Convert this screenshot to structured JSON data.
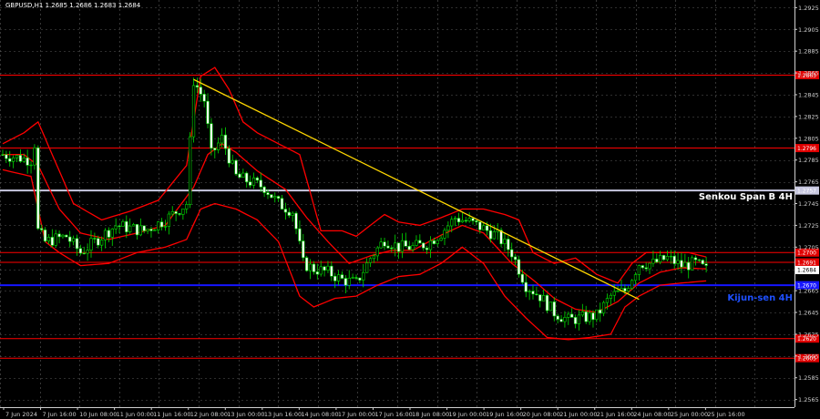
{
  "chart_data": {
    "type": "candlestick",
    "title": "GBPUSD,H1  1.2685 1.2686 1.2683 1.2684",
    "x_labels": [
      "7 Jun 2024",
      "7 Jun 16:00",
      "10 Jun 08:00",
      "11 Jun 00:00",
      "11 Jun 16:00",
      "12 Jun 08:00",
      "13 Jun 00:00",
      "13 Jun 16:00",
      "14 Jun 08:00",
      "17 Jun 00:00",
      "17 Jun 16:00",
      "18 Jun 08:00",
      "19 Jun 00:00",
      "19 Jun 16:00",
      "20 Jun 08:00",
      "21 Jun 00:00",
      "21 Jun 16:00",
      "24 Jun 08:00",
      "25 Jun 00:00",
      "25 Jun 16:00"
    ],
    "y_ticks": [
      "1.2925",
      "1.2905",
      "1.2885",
      "1.2865",
      "1.2845",
      "1.2825",
      "1.2805",
      "1.2785",
      "1.2765",
      "1.2745",
      "1.2725",
      "1.2705",
      "1.2684",
      "1.2665",
      "1.2645",
      "1.2625",
      "1.2605",
      "1.2585",
      "1.2565"
    ],
    "ylim": [
      1.2558,
      1.2932
    ],
    "n_bars": 200,
    "levels": [
      {
        "value": 1.2863,
        "color": "#ff0000",
        "tag": "1.2863"
      },
      {
        "value": 1.2796,
        "color": "#ff0000",
        "tag": "1.2796"
      },
      {
        "value": 1.27,
        "color": "#ff0000",
        "tag": "1.2700"
      },
      {
        "value": 1.2691,
        "color": "#ff0000",
        "tag": "1.2691"
      },
      {
        "value": 1.2621,
        "color": "#ff0000",
        "tag": "1.2620"
      },
      {
        "value": 1.2603,
        "color": "#ff0000",
        "tag": "1.2605"
      }
    ],
    "senkou_span_b": {
      "value": 1.2757,
      "label": "Senkou Span B 4H",
      "tag": "1.2757",
      "color": "#c8c8e0"
    },
    "kijun_sen": {
      "value": 1.267,
      "label": "Kijun-sen 4H",
      "tag": "1.2670",
      "color": "#1515ff"
    },
    "current_price": {
      "value": 1.2684,
      "tag": "1.2684"
    },
    "trendline": {
      "start": {
        "bar": 54,
        "price": 1.2859
      },
      "end": {
        "bar": 180,
        "price": 1.2657
      },
      "color": "#ffd700"
    },
    "price_path": [
      [
        0,
        1.279
      ],
      [
        8,
        1.2785
      ],
      [
        9,
        1.28
      ],
      [
        10,
        1.272
      ],
      [
        12,
        1.271
      ],
      [
        18,
        1.2715
      ],
      [
        22,
        1.27
      ],
      [
        26,
        1.271
      ],
      [
        32,
        1.2725
      ],
      [
        40,
        1.272
      ],
      [
        46,
        1.273
      ],
      [
        52,
        1.2745
      ],
      [
        54,
        1.2858
      ],
      [
        57,
        1.284
      ],
      [
        59,
        1.279
      ],
      [
        62,
        1.2805
      ],
      [
        66,
        1.277
      ],
      [
        70,
        1.2765
      ],
      [
        74,
        1.276
      ],
      [
        78,
        1.2745
      ],
      [
        82,
        1.2738
      ],
      [
        85,
        1.269
      ],
      [
        88,
        1.2685
      ],
      [
        92,
        1.2682
      ],
      [
        96,
        1.2675
      ],
      [
        100,
        1.2672
      ],
      [
        104,
        1.2695
      ],
      [
        108,
        1.2712
      ],
      [
        112,
        1.2705
      ],
      [
        116,
        1.2705
      ],
      [
        120,
        1.2708
      ],
      [
        124,
        1.2718
      ],
      [
        128,
        1.2732
      ],
      [
        132,
        1.2728
      ],
      [
        136,
        1.2722
      ],
      [
        140,
        1.2715
      ],
      [
        144,
        1.27
      ],
      [
        148,
        1.267
      ],
      [
        152,
        1.266
      ],
      [
        156,
        1.2645
      ],
      [
        160,
        1.2638
      ],
      [
        164,
        1.264
      ],
      [
        168,
        1.2642
      ],
      [
        172,
        1.266
      ],
      [
        176,
        1.2665
      ],
      [
        180,
        1.269
      ],
      [
        184,
        1.269
      ],
      [
        188,
        1.2695
      ],
      [
        192,
        1.2688
      ],
      [
        196,
        1.269
      ],
      [
        199,
        1.2684
      ]
    ],
    "bands_upper_path": [
      [
        0,
        1.28
      ],
      [
        6,
        1.281
      ],
      [
        10,
        1.282
      ],
      [
        14,
        1.279
      ],
      [
        20,
        1.2745
      ],
      [
        28,
        1.273
      ],
      [
        36,
        1.2738
      ],
      [
        44,
        1.2748
      ],
      [
        52,
        1.278
      ],
      [
        56,
        1.2862
      ],
      [
        60,
        1.287
      ],
      [
        64,
        1.285
      ],
      [
        68,
        1.282
      ],
      [
        72,
        1.281
      ],
      [
        78,
        1.28
      ],
      [
        84,
        1.279
      ],
      [
        90,
        1.272
      ],
      [
        96,
        1.272
      ],
      [
        100,
        1.2715
      ],
      [
        104,
        1.2725
      ],
      [
        108,
        1.2735
      ],
      [
        112,
        1.2728
      ],
      [
        118,
        1.2725
      ],
      [
        124,
        1.2732
      ],
      [
        130,
        1.274
      ],
      [
        136,
        1.274
      ],
      [
        142,
        1.2735
      ],
      [
        146,
        1.273
      ],
      [
        150,
        1.27
      ],
      [
        156,
        1.269
      ],
      [
        162,
        1.2695
      ],
      [
        168,
        1.268
      ],
      [
        174,
        1.2672
      ],
      [
        178,
        1.269
      ],
      [
        182,
        1.27
      ],
      [
        188,
        1.27
      ],
      [
        194,
        1.27
      ],
      [
        199,
        1.2696
      ]
    ],
    "bands_mid_path": [
      [
        0,
        1.279
      ],
      [
        6,
        1.279
      ],
      [
        10,
        1.278
      ],
      [
        16,
        1.274
      ],
      [
        22,
        1.2718
      ],
      [
        30,
        1.2712
      ],
      [
        38,
        1.2718
      ],
      [
        46,
        1.2725
      ],
      [
        54,
        1.276
      ],
      [
        58,
        1.279
      ],
      [
        62,
        1.28
      ],
      [
        66,
        1.2792
      ],
      [
        72,
        1.2775
      ],
      [
        80,
        1.2758
      ],
      [
        86,
        1.2732
      ],
      [
        92,
        1.271
      ],
      [
        98,
        1.269
      ],
      [
        104,
        1.2697
      ],
      [
        110,
        1.2702
      ],
      [
        116,
        1.2702
      ],
      [
        124,
        1.2716
      ],
      [
        130,
        1.2725
      ],
      [
        136,
        1.2718
      ],
      [
        144,
        1.269
      ],
      [
        150,
        1.2675
      ],
      [
        156,
        1.2658
      ],
      [
        162,
        1.2648
      ],
      [
        168,
        1.2645
      ],
      [
        174,
        1.2655
      ],
      [
        180,
        1.2672
      ],
      [
        186,
        1.2682
      ],
      [
        192,
        1.2686
      ],
      [
        199,
        1.2685
      ]
    ],
    "bands_lower_path": [
      [
        0,
        1.2776
      ],
      [
        8,
        1.277
      ],
      [
        12,
        1.271
      ],
      [
        16,
        1.27
      ],
      [
        22,
        1.2688
      ],
      [
        30,
        1.269
      ],
      [
        38,
        1.27
      ],
      [
        46,
        1.2705
      ],
      [
        52,
        1.2712
      ],
      [
        56,
        1.274
      ],
      [
        60,
        1.2745
      ],
      [
        66,
        1.274
      ],
      [
        72,
        1.273
      ],
      [
        78,
        1.271
      ],
      [
        84,
        1.266
      ],
      [
        88,
        1.265
      ],
      [
        94,
        1.2658
      ],
      [
        100,
        1.266
      ],
      [
        106,
        1.267
      ],
      [
        112,
        1.2678
      ],
      [
        118,
        1.268
      ],
      [
        124,
        1.269
      ],
      [
        130,
        1.2705
      ],
      [
        136,
        1.269
      ],
      [
        142,
        1.266
      ],
      [
        148,
        1.264
      ],
      [
        154,
        1.2622
      ],
      [
        160,
        1.262
      ],
      [
        166,
        1.2622
      ],
      [
        172,
        1.2625
      ],
      [
        176,
        1.265
      ],
      [
        180,
        1.266
      ],
      [
        186,
        1.267
      ],
      [
        192,
        1.2672
      ],
      [
        199,
        1.2674
      ]
    ]
  }
}
